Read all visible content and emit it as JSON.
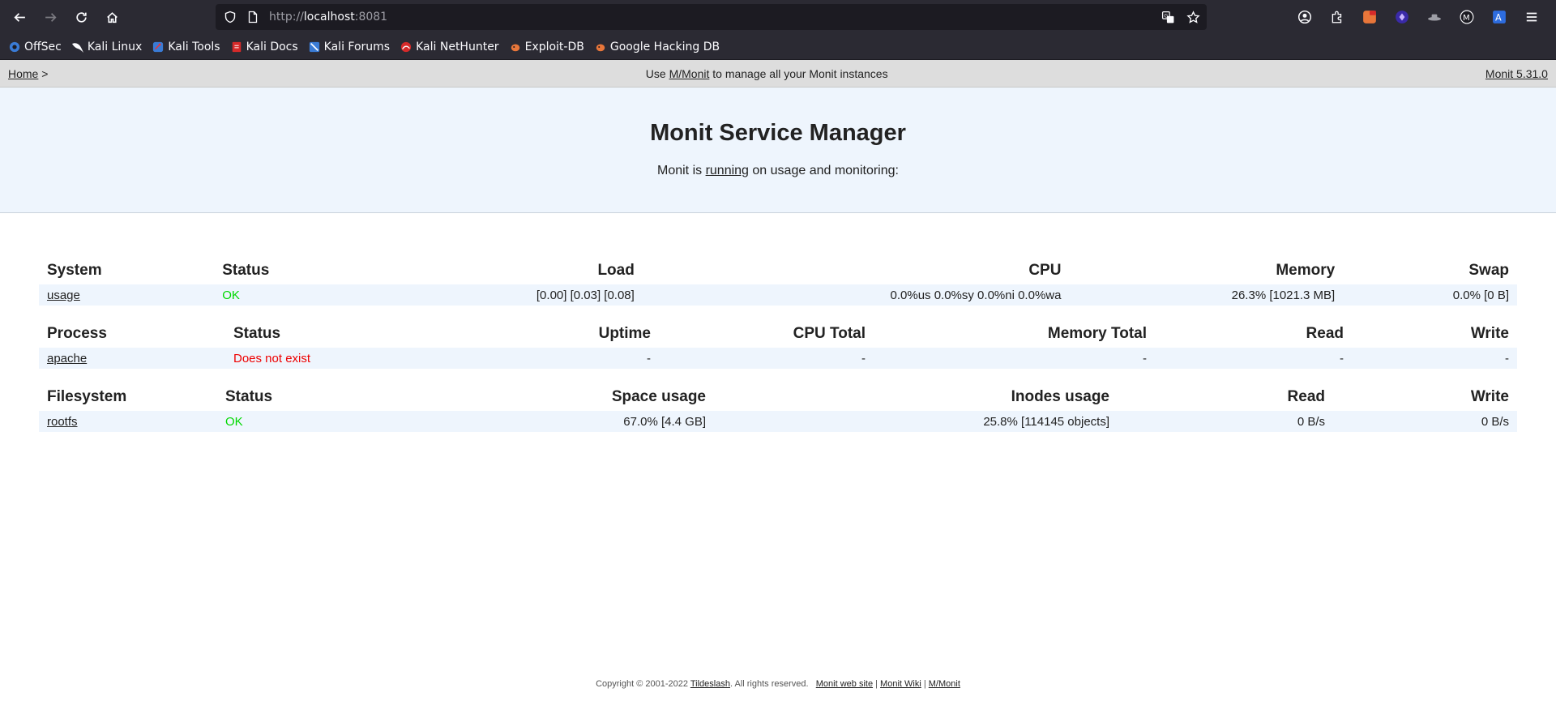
{
  "browser": {
    "url_scheme": "http://",
    "url_host": "localhost",
    "url_port": ":8081",
    "bookmarks": [
      {
        "label": "OffSec",
        "icon": "offsec-icon"
      },
      {
        "label": "Kali Linux",
        "icon": "kali-dragon-icon"
      },
      {
        "label": "Kali Tools",
        "icon": "kali-tools-icon"
      },
      {
        "label": "Kali Docs",
        "icon": "kali-docs-icon"
      },
      {
        "label": "Kali Forums",
        "icon": "kali-forums-icon"
      },
      {
        "label": "Kali NetHunter",
        "icon": "nethunter-icon"
      },
      {
        "label": "Exploit-DB",
        "icon": "exploit-db-icon"
      },
      {
        "label": "Google Hacking DB",
        "icon": "ghdb-icon"
      }
    ]
  },
  "topnav": {
    "home": "Home",
    "sep": ">",
    "use_prefix": "Use",
    "mmonit_link": "M/Monit",
    "use_suffix": "to manage all your Monit instances",
    "version": "Monit 5.31.0"
  },
  "header": {
    "title": "Monit Service Manager",
    "status_prefix": "Monit is",
    "status_link": "running",
    "status_suffix": "on usage and monitoring:"
  },
  "system": {
    "headers": [
      "System",
      "Status",
      "Load",
      "CPU",
      "Memory",
      "Swap"
    ],
    "row": {
      "name": "usage",
      "status": "OK",
      "load": "[0.00] [0.03] [0.08]",
      "cpu": "0.0%us 0.0%sy 0.0%ni 0.0%wa",
      "memory": "26.3% [1021.3 MB]",
      "swap": "0.0% [0 B]"
    }
  },
  "process": {
    "headers": [
      "Process",
      "Status",
      "Uptime",
      "CPU Total",
      "Memory Total",
      "Read",
      "Write"
    ],
    "row": {
      "name": "apache",
      "status": "Does not exist",
      "uptime": "-",
      "cpu_total": "-",
      "memory_total": "-",
      "read": "-",
      "write": "-"
    }
  },
  "filesystem": {
    "headers": [
      "Filesystem",
      "Status",
      "Space usage",
      "Inodes usage",
      "Read",
      "Write"
    ],
    "row": {
      "name": "rootfs",
      "status": "OK",
      "space": "67.0% [4.4 GB]",
      "inodes": "25.8% [114145 objects]",
      "read": "0 B/s",
      "write": "0 B/s"
    }
  },
  "footer": {
    "copyright": "Copyright © 2001-2022",
    "company": "Tildeslash",
    "rights": ". All rights reserved.",
    "website": "Monit web site",
    "wiki": "Monit Wiki",
    "mmonit": "M/Monit",
    "sep": "|"
  },
  "colors": {
    "ok": "#00d800",
    "error": "#ee0000",
    "header_bg": "#eef5fd"
  }
}
